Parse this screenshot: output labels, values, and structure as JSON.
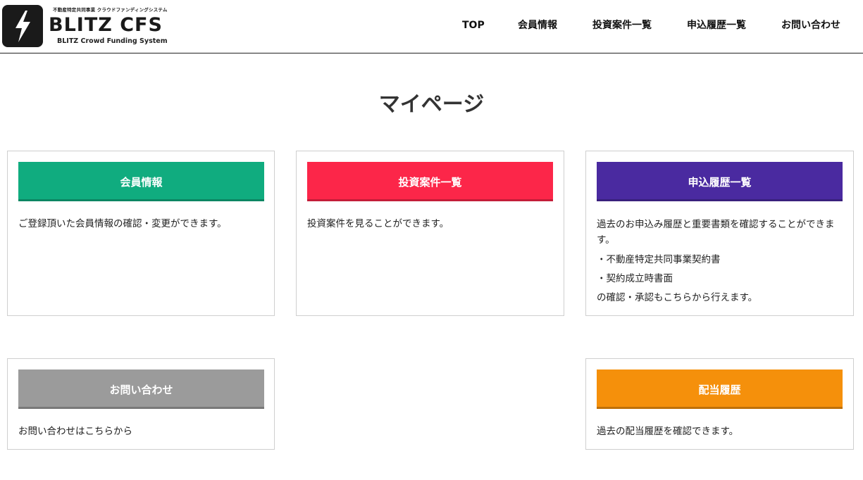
{
  "header": {
    "logo": {
      "tagline": "不動産特定共同事業 クラウドファンディングシステム",
      "name": "BLITZ CFS",
      "subtitle": "BLITZ Crowd Funding System"
    },
    "nav": [
      "TOP",
      "会員情報",
      "投資案件一覧",
      "申込履歴一覧",
      "お問い合わせ"
    ]
  },
  "page_title": "マイページ",
  "cards": [
    {
      "label": "会員情報",
      "color": "#10ac7f",
      "desc": [
        "ご登録頂いた会員情報の確認・変更ができます。"
      ]
    },
    {
      "label": "投資案件一覧",
      "color": "#fc2649",
      "desc": [
        "投資案件を見ることができます。"
      ]
    },
    {
      "label": "申込履歴一覧",
      "color": "#4a2aa0",
      "desc": [
        "過去のお申込み履歴と重要書類を確認することができます。",
        "・不動産特定共同事業契約書",
        "・契約成立時書面",
        "の確認・承認もこちらから行えます。"
      ]
    },
    {
      "label": "お問い合わせ",
      "color": "#9b9b9b",
      "desc": [
        "お問い合わせはこちらから"
      ]
    },
    {
      "label": "配当履歴",
      "color": "#f5900b",
      "desc": [
        "過去の配当履歴を確認できます。"
      ]
    }
  ]
}
